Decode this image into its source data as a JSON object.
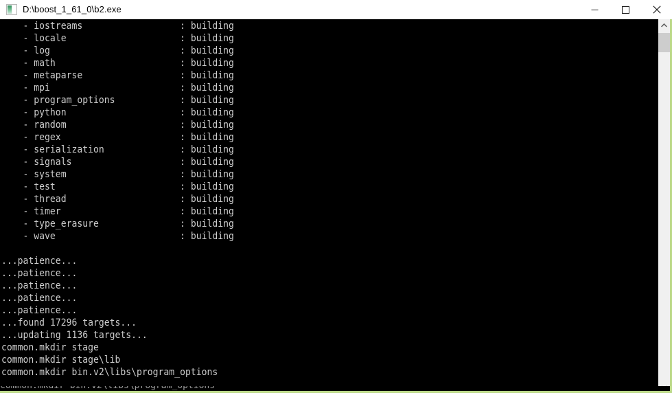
{
  "window": {
    "title": "D:\\boost_1_61_0\\b2.exe",
    "icon": "console-app-icon",
    "controls": {
      "minimize_label": "Minimize",
      "maximize_label": "Maximize",
      "close_label": "Close"
    },
    "border_color": "#bcd98a",
    "titlebar_bg": "#ffffff",
    "console_bg": "#000000",
    "console_fg": "#cccccc"
  },
  "scrollbar": {
    "orientation": "vertical",
    "up_arrow": "▲",
    "down_arrow": "▼",
    "thumb_position_percent": 4
  },
  "console": {
    "library_status_value": "building",
    "libraries": [
      "iostreams",
      "locale",
      "log",
      "math",
      "metaparse",
      "mpi",
      "program_options",
      "python",
      "random",
      "regex",
      "serialization",
      "signals",
      "system",
      "test",
      "thread",
      "timer",
      "type_erasure",
      "wave"
    ],
    "status_lines": [
      "...patience...",
      "...patience...",
      "...patience...",
      "...patience...",
      "...patience...",
      "...found 17296 targets...",
      "...updating 1136 targets...",
      "common.mkdir stage",
      "common.mkdir stage\\lib",
      "common.mkdir bin.v2\\libs\\program_options"
    ],
    "full_text": "    - iostreams                  : building\n    - locale                     : building\n    - log                        : building\n    - math                       : building\n    - metaparse                  : building\n    - mpi                        : building\n    - program_options            : building\n    - python                     : building\n    - random                     : building\n    - regex                      : building\n    - serialization              : building\n    - signals                    : building\n    - system                     : building\n    - test                       : building\n    - thread                     : building\n    - timer                      : building\n    - type_erasure               : building\n    - wave                       : building\n\n...patience...\n...patience...\n...patience...\n...patience...\n...patience...\n...found 17296 targets...\n...updating 1136 targets...\ncommon.mkdir stage\ncommon.mkdir stage\\lib\ncommon.mkdir bin.v2\\libs\\program_options"
  }
}
